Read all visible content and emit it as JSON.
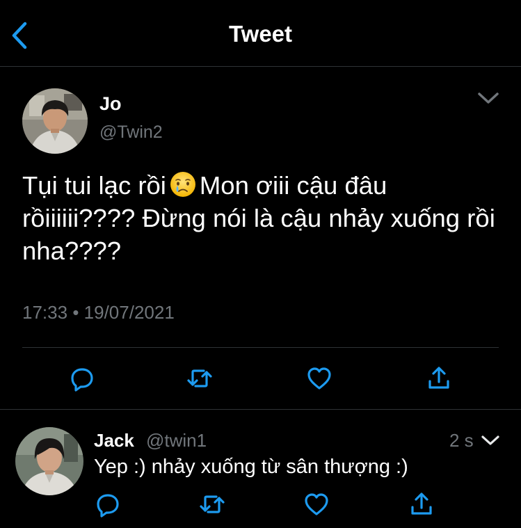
{
  "header": {
    "title": "Tweet",
    "back_icon": "chevron-left-icon",
    "accent_color": "#1d9bf0"
  },
  "tweet": {
    "author_name": "Jo",
    "author_handle": "@Twin2",
    "text_part1": "Tụi tui lạc rồi",
    "emoji": "crying-face-emoji",
    "text_part2": "Mon ơiii cậu đâu rồiiiiii???? Đừng nói là cậu nhảy xuống rồi nha????",
    "time": "17:33",
    "dot": "•",
    "date": "19/07/2021",
    "actions": [
      "reply-icon",
      "retweet-icon",
      "like-icon",
      "share-icon"
    ]
  },
  "reply": {
    "author_name": "Jack",
    "author_handle": "@twin1",
    "time_ago": "2 s",
    "text": "Yep :) nhảy xuống từ sân thượng :)",
    "actions": [
      "reply-icon",
      "retweet-icon",
      "like-icon",
      "share-icon"
    ]
  },
  "colors": {
    "background": "#000000",
    "secondary_text": "#71767b",
    "divider": "#2f3336"
  }
}
